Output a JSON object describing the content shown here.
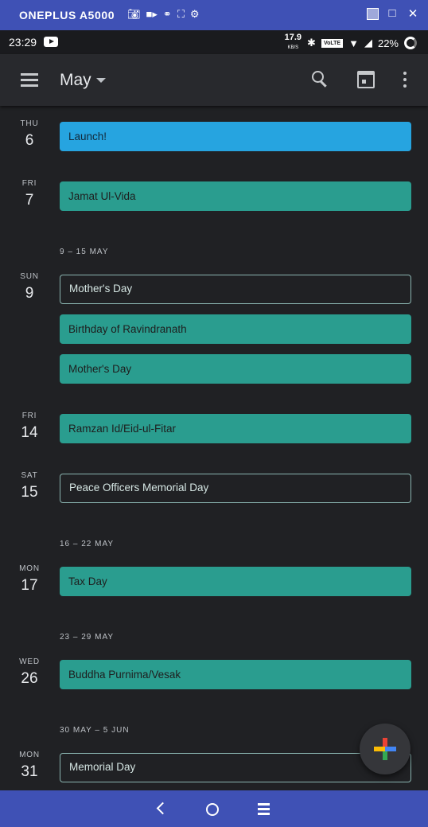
{
  "window": {
    "title": "ONEPLUS A5000",
    "tool_icons": [
      "camera-icon",
      "video-icon",
      "headset-icon",
      "fullscreen-icon",
      "settings-icon"
    ],
    "controls": [
      "minimize-icon",
      "maximize-icon",
      "close-icon"
    ],
    "accent": "#3f51b5"
  },
  "status_bar": {
    "time": "23:29",
    "speed_value": "17.9",
    "speed_unit": "KB/S",
    "volte": "VoLTE",
    "battery": "22%"
  },
  "app_bar": {
    "month": "May"
  },
  "agenda": [
    {
      "type": "day",
      "weekday": "THU",
      "date": "6",
      "events": [
        {
          "title": "Launch!",
          "style": "blue"
        }
      ]
    },
    {
      "type": "day",
      "weekday": "FRI",
      "date": "7",
      "events": [
        {
          "title": "Jamat Ul-Vida",
          "style": "filled"
        }
      ]
    },
    {
      "type": "week",
      "label": "9 – 15 MAY"
    },
    {
      "type": "day",
      "weekday": "SUN",
      "date": "9",
      "events": [
        {
          "title": "Mother's Day",
          "style": "outline"
        },
        {
          "title": "Birthday of Ravindranath",
          "style": "filled"
        },
        {
          "title": "Mother's Day",
          "style": "filled"
        }
      ]
    },
    {
      "type": "day",
      "weekday": "FRI",
      "date": "14",
      "events": [
        {
          "title": "Ramzan Id/Eid-ul-Fitar",
          "style": "filled"
        }
      ]
    },
    {
      "type": "day",
      "weekday": "SAT",
      "date": "15",
      "events": [
        {
          "title": "Peace Officers Memorial Day",
          "style": "outline"
        }
      ]
    },
    {
      "type": "week",
      "label": "16 – 22 MAY"
    },
    {
      "type": "day",
      "weekday": "MON",
      "date": "17",
      "events": [
        {
          "title": "Tax Day",
          "style": "filled"
        }
      ]
    },
    {
      "type": "week",
      "label": "23 – 29 MAY"
    },
    {
      "type": "day",
      "weekday": "WED",
      "date": "26",
      "events": [
        {
          "title": "Buddha Purnima/Vesak",
          "style": "filled"
        }
      ]
    },
    {
      "type": "week",
      "label": "30 MAY – 5 JUN"
    },
    {
      "type": "day",
      "weekday": "MON",
      "date": "31",
      "events": [
        {
          "title": "Memorial Day",
          "style": "outline"
        },
        {
          "title": "",
          "style": "filled"
        }
      ]
    }
  ],
  "colors": {
    "event_teal": "#2a9d8f",
    "event_blue": "#26a4e0",
    "background": "#202124"
  }
}
